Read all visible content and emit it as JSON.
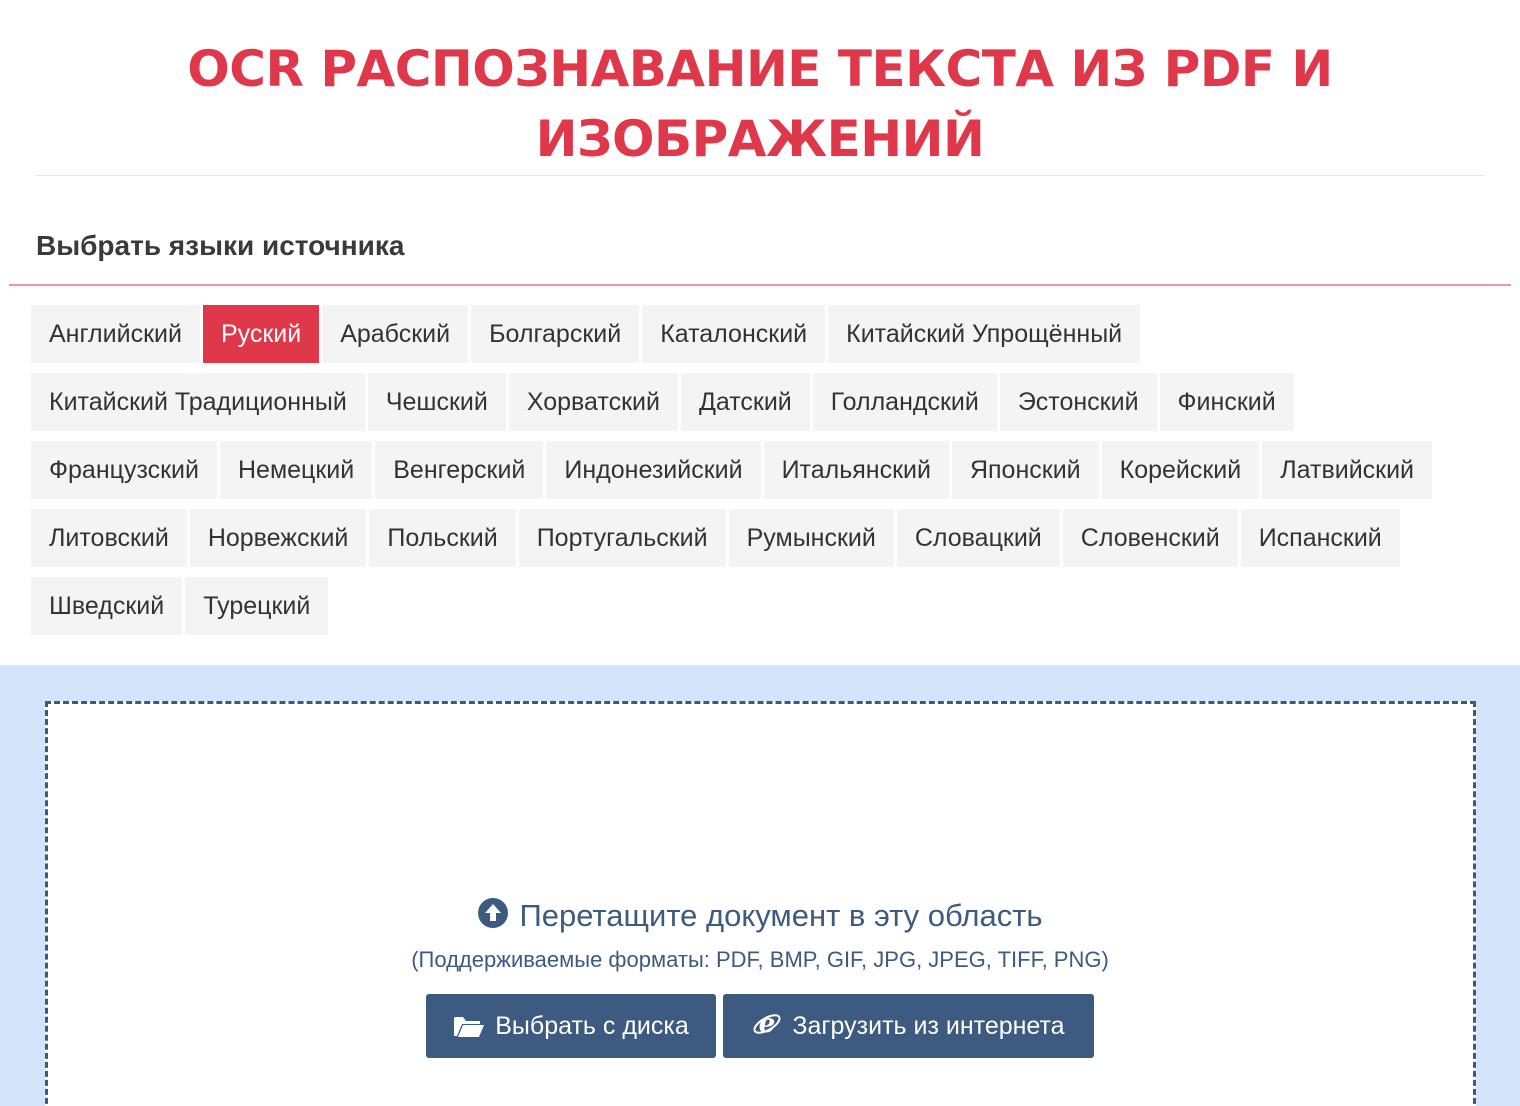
{
  "header": {
    "title_line1": "OCR РАСПОЗНАВАНИЕ ТЕКСТА ИЗ PDF И",
    "title_line2": "ИЗОБРАЖЕНИЙ"
  },
  "languages": {
    "label": "Выбрать языки источника",
    "selected": "Руский",
    "rows": [
      [
        "Английский",
        "Руский",
        "Арабский",
        "Болгарский",
        "Каталонский",
        "Китайский Упрощённый"
      ],
      [
        "Китайский Традиционный",
        "Чешский",
        "Хорватский",
        "Датский",
        "Голландский",
        "Эстонский",
        "Финский"
      ],
      [
        "Французский",
        "Немецкий",
        "Венгерский",
        "Индонезийский",
        "Итальянский",
        "Японский",
        "Корейский",
        "Латвийский"
      ],
      [
        "Литовский",
        "Норвежский",
        "Польский",
        "Португальский",
        "Румынский",
        "Словацкий",
        "Словенский",
        "Испанский"
      ],
      [
        "Шведский",
        "Турецкий"
      ]
    ]
  },
  "upload": {
    "drop_text": "Перетащите документ в эту область",
    "formats_text": "(Поддерживаемые форматы: PDF, BMP, GIF, JPG, JPEG, TIFF, PNG)",
    "disk_button": "Выбрать с диска",
    "web_button": "Загрузить из интернета"
  },
  "colors": {
    "accent": "#e0384b",
    "primary": "#3d5a80",
    "band": "#d3e4fb"
  },
  "icons": {
    "upload": "arrow-up-circle-icon",
    "folder": "folder-open-icon",
    "web": "internet-explorer-icon"
  }
}
